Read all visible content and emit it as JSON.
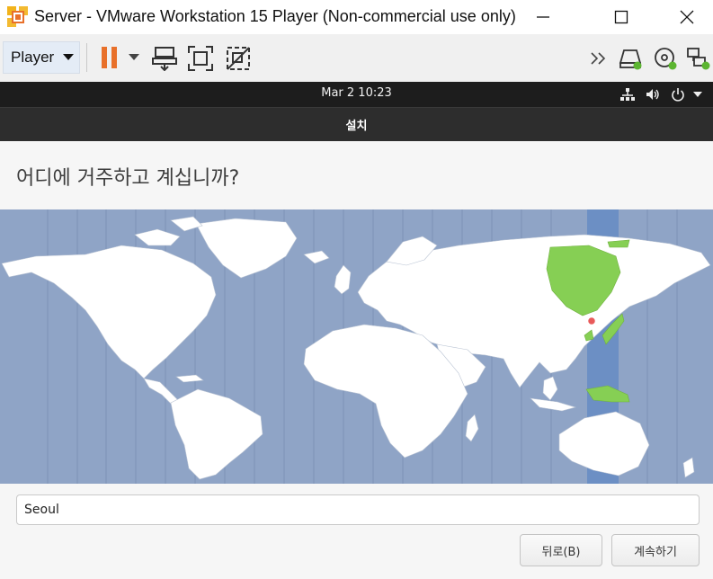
{
  "window": {
    "title": "Server - VMware Workstation 15 Player (Non-commercial use only)",
    "controls": [
      "minimize-icon",
      "maximize-icon",
      "close-icon"
    ]
  },
  "toolbar": {
    "player_menu_label": "Player",
    "icons": [
      "pause-icon",
      "dropdown-arrow-icon",
      "send-ctrl-alt-del-icon",
      "fullscreen-icon",
      "unity-icon",
      "more-devices-icon",
      "hard-disk-icon",
      "cd-dvd-icon",
      "network-adapter-icon"
    ],
    "accent_color": "#e8702a",
    "status_color": "#5cb531"
  },
  "ubuntu_topbar": {
    "clock": "Mar 2  10:23",
    "icons": [
      "network-icon",
      "volume-icon",
      "power-icon",
      "menu-arrow-icon"
    ]
  },
  "installer": {
    "header_title": "설치",
    "question": "어디에 거주하고 계십니까?",
    "timezone_map": {
      "selected_city": "Seoul",
      "highlight_color": "#86cf54",
      "selected_band_color": "#6c8fc4",
      "ocean_color": "#8fa4c6"
    },
    "city_field_value": "Seoul",
    "back_button": "뒤로(B)",
    "continue_button": "계속하기"
  }
}
